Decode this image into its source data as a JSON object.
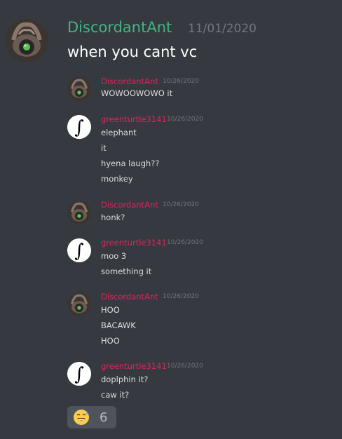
{
  "main_message": {
    "author": "DiscordantAnt",
    "timestamp": "11/01/2020",
    "text": "when you cant vc",
    "author_color": "#43b581"
  },
  "embedded_messages": [
    {
      "author": "DiscordantAnt",
      "timestamp": "10/26/2020",
      "avatar": "ant-avatar",
      "lines": [
        "WOWOOWOWO it"
      ]
    },
    {
      "author": "greenturtle3141",
      "timestamp": "10/26/2020",
      "avatar": "integral-avatar",
      "lines": [
        "elephant",
        "it",
        "hyena laugh??",
        "monkey"
      ]
    },
    {
      "author": "DiscordantAnt",
      "timestamp": "10/26/2020",
      "avatar": "ant-avatar",
      "lines": [
        "honk?"
      ]
    },
    {
      "author": "greenturtle3141",
      "timestamp": "10/26/2020",
      "avatar": "integral-avatar",
      "lines": [
        "moo 3",
        "something it"
      ]
    },
    {
      "author": "DiscordantAnt",
      "timestamp": "10/26/2020",
      "avatar": "ant-avatar",
      "lines": [
        "HOO",
        "BACAWK",
        "HOO"
      ]
    },
    {
      "author": "greenturtle3141",
      "timestamp": "10/26/2020",
      "avatar": "integral-avatar",
      "lines": [
        "doplphin it?",
        "caw it?"
      ]
    }
  ],
  "embedded_author_color": "#e0245e",
  "reaction": {
    "emoji": "sweat-smile-emoji",
    "count": "6"
  }
}
